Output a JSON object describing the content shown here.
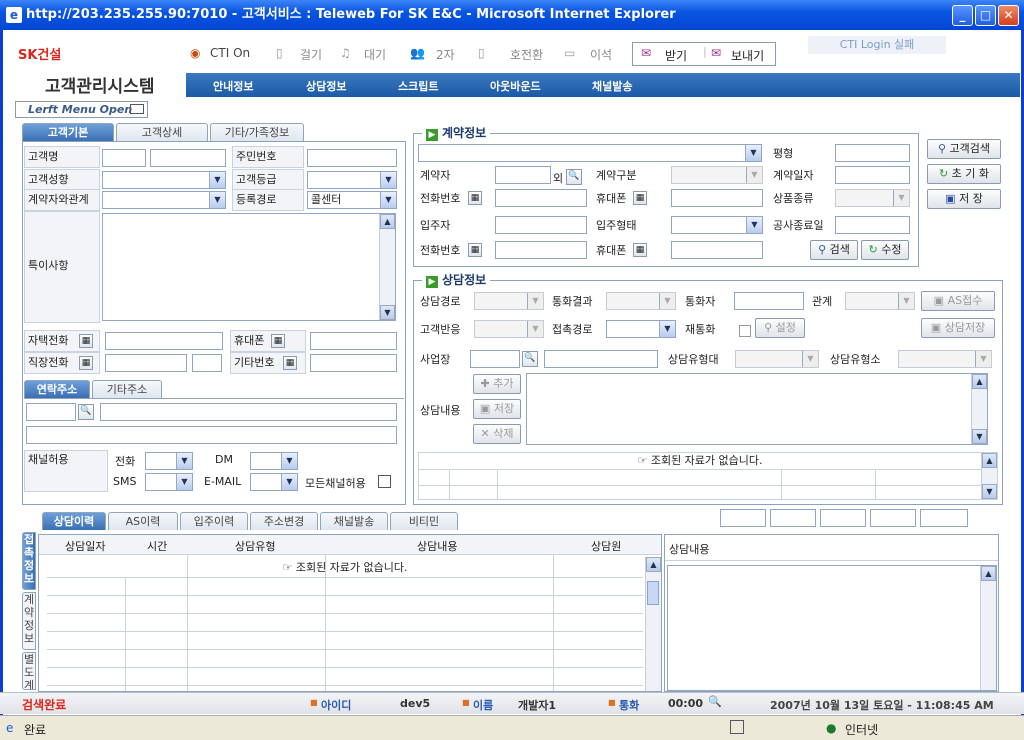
{
  "window": {
    "title": "http://203.235.255.90:7010 - 고객서비스 : Teleweb For SK E&C - Microsoft Internet Explorer",
    "btn_min": "_",
    "btn_max": "□",
    "btn_close": "✕"
  },
  "brand": {
    "logo": "SK건설",
    "system": "고객관리시스템"
  },
  "toolbar": {
    "cti": "CTI On",
    "call": "걸기",
    "wait": "대기",
    "second": "2자",
    "transfer": "호전환",
    "leave": "이석",
    "receive": "받기",
    "send": "보내기",
    "cti_status": "CTI Login 실패"
  },
  "nav": [
    "안내정보",
    "상담정보",
    "스크립트",
    "아웃바운드",
    "채널발송"
  ],
  "left_menu": "Lerft Menu Open",
  "customer": {
    "tabs": [
      "고객기본",
      "고객상세",
      "기타/가족정보"
    ],
    "name": "고객명",
    "ssn": "주민번호",
    "tendency": "고객성향",
    "grade": "고객등급",
    "relation": "계약자와관계",
    "route": "등록경로",
    "route_value": "콜센터",
    "note": "특이사항",
    "home_phone": "자택전화",
    "mobile": "휴대폰",
    "work_phone": "직장전화",
    "other_no": "기타번호",
    "addr_tabs": [
      "연락주소",
      "기타주소"
    ],
    "channel": "채널허용",
    "tel": "전화",
    "dm": "DM",
    "sms": "SMS",
    "email": "E-MAIL",
    "all_channel": "모든채널허용"
  },
  "contract": {
    "title": "계약정보",
    "pyeong": "평형",
    "contractor": "계약자",
    "extra": "외",
    "type": "계약구분",
    "date": "계약일자",
    "phone": "전화번호",
    "mobile": "휴대폰",
    "product": "상품종류",
    "resident": "입주자",
    "move_type": "입주형태",
    "end_date": "공사종료일",
    "phone2": "전화번호",
    "mobile2": "휴대폰",
    "search": "검색",
    "edit": "수정"
  },
  "side_buttons": [
    "고객검색",
    "초 기 화",
    "저   장"
  ],
  "consult": {
    "title": "상담정보",
    "route": "상담경로",
    "result": "통화결과",
    "caller": "통화자",
    "relation": "관계",
    "as_btn": "AS접수",
    "reaction": "고객반응",
    "contact": "접촉경로",
    "recall": "재통화",
    "setting": "설정",
    "save_btn": "상담저장",
    "site": "사업장",
    "type_large": "상담유형대",
    "type_small": "상담유형소",
    "content": "상담내용",
    "add": "추가",
    "save": "저장",
    "delete": "삭제",
    "empty": "☞ 조회된 자료가 없습니다."
  },
  "history": {
    "tabs": [
      "상담이력",
      "AS이력",
      "입주이력",
      "주소변경",
      "채널발송",
      "비티민"
    ],
    "side_tabs": [
      "접촉정보",
      "계약정보",
      "별도계"
    ],
    "columns": [
      "상담일자",
      "시간",
      "상담유형",
      "상담내용",
      "상담원"
    ],
    "empty": "☞ 조회된 자료가 없습니다.",
    "detail_title": "상담내용"
  },
  "status": {
    "msg": "검색완료",
    "id_label": "아이디",
    "id": "dev5",
    "name_label": "이름",
    "name": "개발자1",
    "call_label": "통화",
    "call_time": "00:00",
    "datetime": "2007년 10월 13일 토요일 - 11:08:45 AM"
  },
  "ie": {
    "done": "완료",
    "zone": "인터넷"
  }
}
